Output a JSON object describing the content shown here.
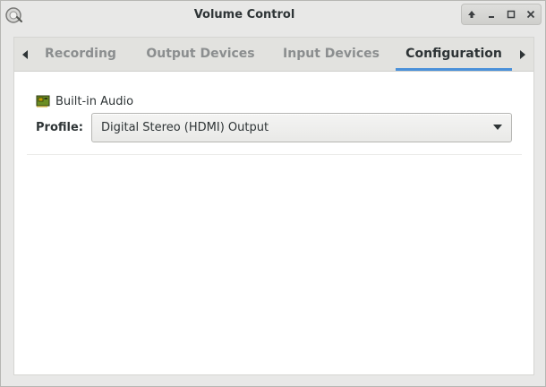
{
  "window": {
    "title": "Volume Control"
  },
  "tabs": [
    {
      "label": "Recording",
      "active": false
    },
    {
      "label": "Output Devices",
      "active": false
    },
    {
      "label": "Input Devices",
      "active": false
    },
    {
      "label": "Configuration",
      "active": true
    }
  ],
  "configuration": {
    "device_name": "Built-in Audio",
    "profile_label": "Profile:",
    "profile_value": "Digital Stereo (HDMI) Output"
  },
  "icons": {
    "app": "volume-control-icon",
    "device": "sound-card-icon",
    "wm_buttons": [
      "keep-above-icon",
      "minimize-icon",
      "maximize-icon",
      "close-icon"
    ],
    "tab_scroll": [
      "chevron-left-icon",
      "chevron-right-icon"
    ],
    "dropdown": "chevron-down-icon"
  },
  "colors": {
    "accent": "#4a90d9",
    "window_bg": "#e8e8e7",
    "content_bg": "#ffffff",
    "active_tab_text": "#2e3436",
    "inactive_tab_text": "#8b8e8f"
  }
}
